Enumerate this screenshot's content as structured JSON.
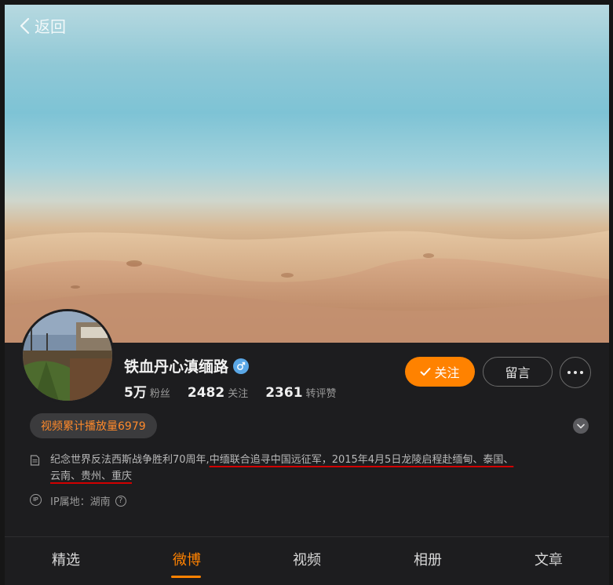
{
  "header": {
    "back_label": "返回"
  },
  "profile": {
    "name": "铁血丹心滇缅路",
    "followers_num": "5万",
    "followers_label": "粉丝",
    "following_num": "2482",
    "following_label": "关注",
    "reposts_num": "2361",
    "reposts_label": "转评赞"
  },
  "actions": {
    "follow_label": "关注",
    "message_label": "留言"
  },
  "plays_badge": "视频累计播放量6979",
  "bio": {
    "text_before": "纪念世界反法西斯战争胜利70周年,",
    "text_line1_underlined": "中缅联合追寻中国远征军，2015年4月5日龙陵启程赴缅甸、泰国、",
    "text_line2_underlined": "云南、贵州、重庆"
  },
  "ip": {
    "label": "IP属地：湖南",
    "icon_text": "IP"
  },
  "tabs": [
    {
      "label": "精选",
      "active": false
    },
    {
      "label": "微博",
      "active": true
    },
    {
      "label": "视频",
      "active": false
    },
    {
      "label": "相册",
      "active": false
    },
    {
      "label": "文章",
      "active": false
    }
  ],
  "colors": {
    "accent": "#ff8200",
    "background": "#1d1d1f",
    "annotation_underline": "#d10000",
    "gender_badge": "#5aa7e6"
  },
  "icons": {
    "back": "chevron-left-icon",
    "gender": "male-icon",
    "follow_check": "check-icon",
    "more": "more-dots-icon",
    "expand": "chevron-down-icon",
    "bio": "document-icon",
    "ip": "ip-icon",
    "help": "question-icon"
  }
}
